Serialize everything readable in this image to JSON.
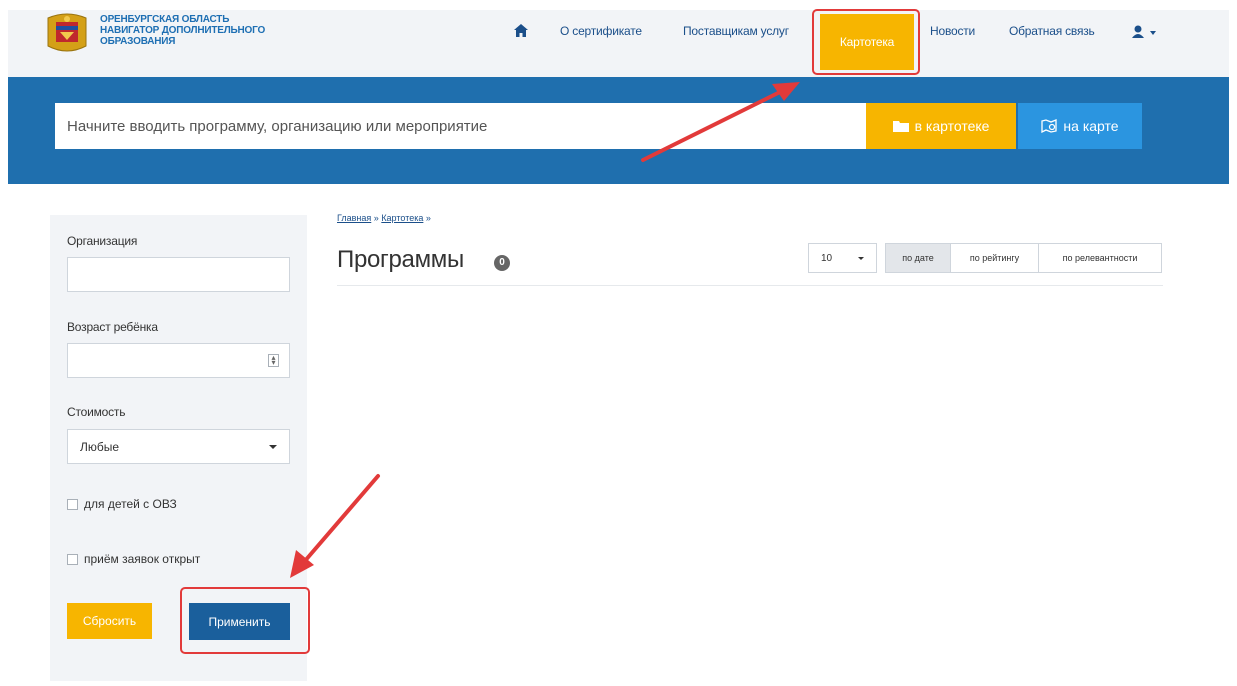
{
  "header": {
    "logo_lines": [
      "ОРЕНБУРГСКАЯ ОБЛАСТЬ",
      "НАВИГАТОР ДОПОЛНИТЕЛЬНОГО",
      "ОБРАЗОВАНИЯ"
    ],
    "nav": {
      "home_icon": "home-icon",
      "about_cert": "О сертификате",
      "providers": "Поставщикам услуг",
      "catalog": "Картотека",
      "news": "Новости",
      "feedback": "Обратная связь",
      "user_icon": "user-icon"
    }
  },
  "search": {
    "placeholder": "Начните вводить программу, организацию или мероприятие",
    "catalog_button": "в картотеке",
    "map_button": "на карте"
  },
  "sidebar": {
    "organization_label": "Организация",
    "organization_value": "",
    "age_label": "Возраст ребёнка",
    "age_value": "",
    "cost_label": "Стоимость",
    "cost_value": "Любые",
    "ovz_label": "для детей с ОВЗ",
    "open_label": "приём заявок открыт",
    "reset_button": "Сбросить",
    "apply_button": "Применить"
  },
  "main": {
    "breadcrumb_home": "Главная",
    "breadcrumb_sep": "»",
    "breadcrumb_catalog": "Картотека",
    "title": "Программы",
    "count": "0",
    "per_page": "10",
    "sort": [
      "по дате",
      "по рейтингу",
      "по релевантности"
    ],
    "active_sort": "по дате"
  },
  "colors": {
    "brand_blue": "#1f6fae",
    "accent_yellow": "#f7b500",
    "map_blue": "#2b95e0",
    "annotation_red": "#e23a3a"
  }
}
